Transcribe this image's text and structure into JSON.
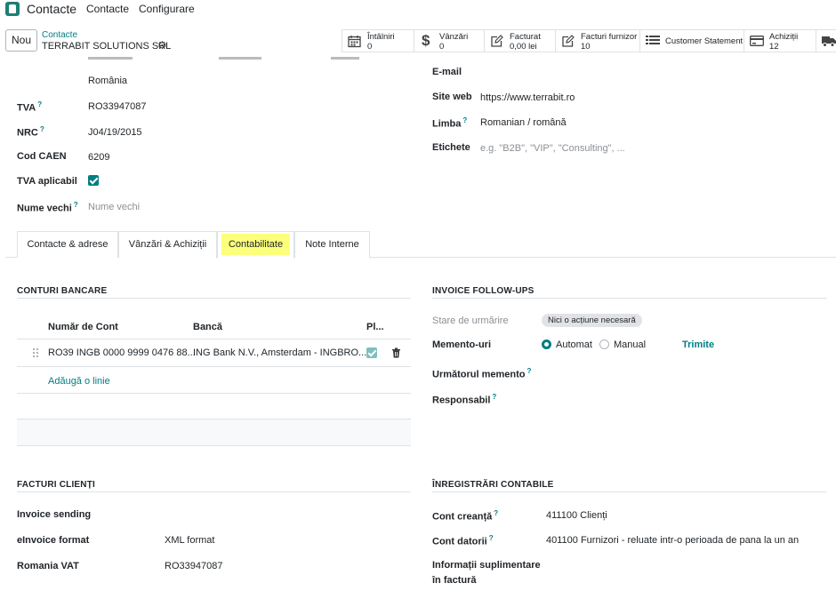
{
  "nav": {
    "app_title": "Contacte",
    "menu": [
      "Contacte",
      "Configurare"
    ]
  },
  "control": {
    "new_label": "Nou",
    "breadcrumb_parent": "Contacte",
    "record_name": "TERRABIT SOLUTIONS SRL"
  },
  "smart_buttons": [
    {
      "icon": "calendar-icon",
      "label": "Întâlniri",
      "value": "0"
    },
    {
      "icon": "dollar-icon",
      "label": "Vânzări",
      "value": "0"
    },
    {
      "icon": "edit-icon",
      "label": "Facturat",
      "value": "0,00 lei"
    },
    {
      "icon": "edit-icon",
      "label": "Facturi furnizor",
      "value": "10"
    },
    {
      "icon": "list-icon",
      "label": "Customer Statement",
      "value": ""
    },
    {
      "icon": "card-icon",
      "label": "Achiziții",
      "value": "12"
    },
    {
      "icon": "truck-icon",
      "label": "",
      "value": ""
    }
  ],
  "left_fields": {
    "country": "România",
    "tva_label": "TVA",
    "tva_value": "RO33947087",
    "nrc_label": "NRC",
    "nrc_value": "J04/19/2015",
    "caen_label": "Cod CAEN",
    "caen_value": "6209",
    "tva_app_label": "TVA aplicabil",
    "old_name_label": "Nume vechi",
    "old_name_placeholder": "Nume vechi"
  },
  "right_fields": {
    "email_label": "E-mail",
    "website_label": "Site web",
    "website_value": "https://www.terrabit.ro",
    "lang_label": "Limba",
    "lang_value": "Romanian / română",
    "tags_label": "Etichete",
    "tags_placeholder": "e.g. \"B2B\", \"VIP\", \"Consulting\", ..."
  },
  "tabs": [
    "Contacte & adrese",
    "Vânzări & Achiziții",
    "Contabilitate",
    "Note Interne"
  ],
  "bank": {
    "section_title": "CONTURI BANCARE",
    "headers": [
      "Număr de Cont",
      "Bancă",
      "Pl..."
    ],
    "rows": [
      {
        "account": "RO39 INGB 0000 9999 0476 88...",
        "bank": "ING Bank N.V., Amsterdam - INGBRO..."
      }
    ],
    "add_line": "Adăugă o linie"
  },
  "followup": {
    "section_title": "INVOICE FOLLOW-UPS",
    "status_label": "Stare de urmărire",
    "status_value": "Nici o acțiune necesară",
    "reminders_label": "Memento-uri",
    "option_auto": "Automat",
    "option_manual": "Manual",
    "send_label": "Trimite",
    "next_label": "Următorul memento",
    "responsible_label": "Responsabil"
  },
  "invoices": {
    "section_title": "FACTURI CLIENȚI",
    "sending_label": "Invoice sending",
    "einvoice_label": "eInvoice format",
    "einvoice_value": "XML format",
    "vat_label": "Romania VAT",
    "vat_value": "RO33947087"
  },
  "accounting": {
    "section_title": "ÎNREGISTRĂRI CONTABILE",
    "receivable_label": "Cont creanță",
    "receivable_value": "411100 Clienți",
    "payable_label": "Cont datorii",
    "payable_value": "401100 Furnizori - reluate intr-o perioada de pana la un an",
    "extra_label_1": "Informații suplimentare",
    "extra_label_2": "în factură"
  }
}
